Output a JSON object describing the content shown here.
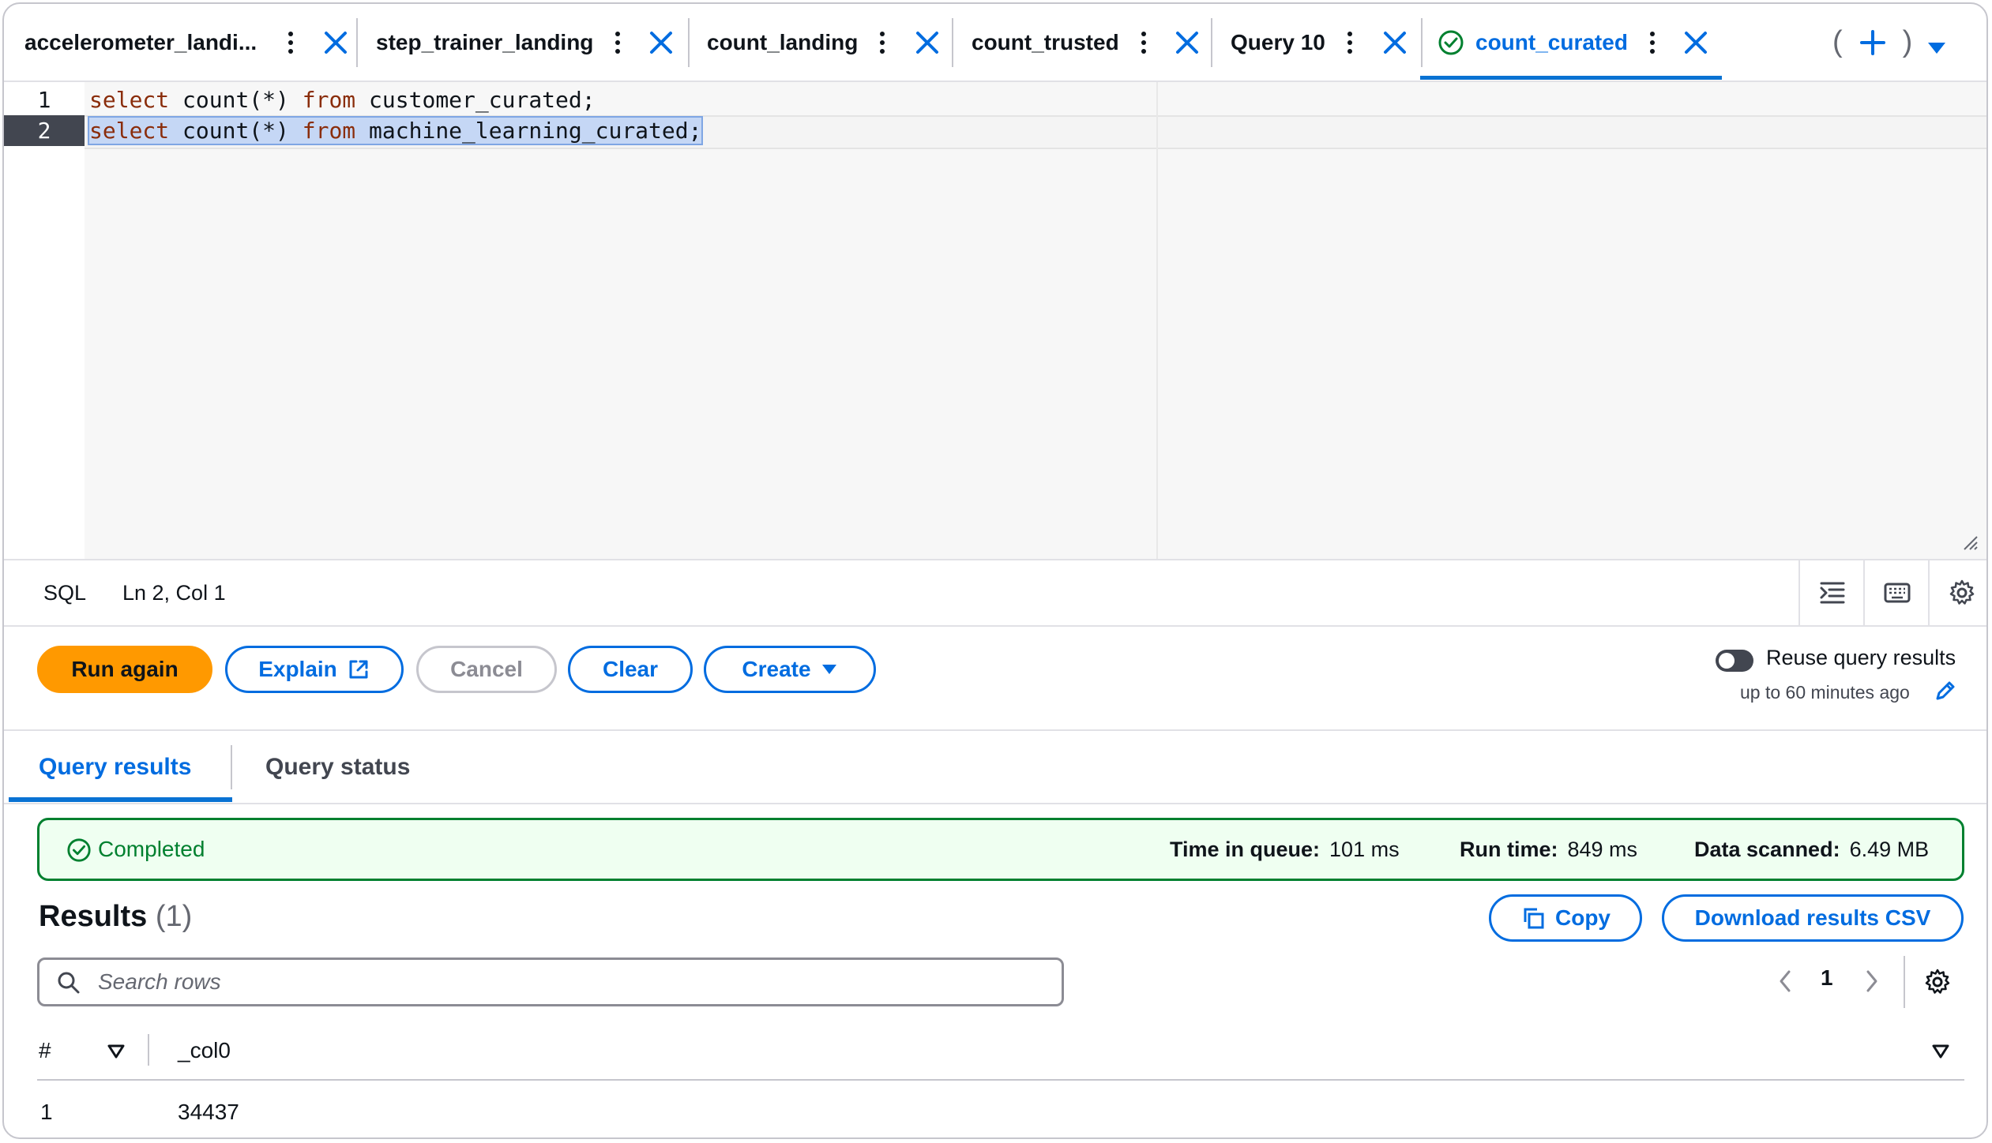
{
  "tabs": [
    {
      "label": "accelerometer_landi..."
    },
    {
      "label": "step_trainer_landing"
    },
    {
      "label": "count_landing"
    },
    {
      "label": "count_trusted"
    },
    {
      "label": "Query 10"
    },
    {
      "label": "count_curated"
    }
  ],
  "tab_actions": {
    "open_paren": "(",
    "close_paren": ")"
  },
  "editor": {
    "lines": [
      {
        "number": "1",
        "kw1": "select",
        "text1": " count(*) ",
        "kw2": "from",
        "text2": " customer_curated;"
      },
      {
        "number": "2",
        "kw1": "select",
        "text1": " count(*) ",
        "kw2": "from",
        "text2": " machine_learning_curated;"
      }
    ]
  },
  "statusbar": {
    "language": "SQL",
    "cursor": "Ln 2, Col 1"
  },
  "actions": {
    "run": "Run again",
    "explain": "Explain",
    "cancel": "Cancel",
    "clear": "Clear",
    "create": "Create",
    "reuse_label": "Reuse query results",
    "reuse_sub": "up to 60 minutes ago"
  },
  "result_tabs": {
    "results": "Query results",
    "status": "Query status"
  },
  "banner": {
    "status": "Completed",
    "queue_label": "Time in queue:",
    "queue_value": "101 ms",
    "run_label": "Run time:",
    "run_value": "849 ms",
    "scan_label": "Data scanned:",
    "scan_value": "6.49 MB"
  },
  "results": {
    "title": "Results",
    "count": "(1)",
    "copy": "Copy",
    "download": "Download results CSV",
    "search_placeholder": "Search rows",
    "page": "1",
    "columns": [
      "#",
      "_col0"
    ],
    "rows": [
      [
        "1",
        "34437"
      ]
    ]
  },
  "colors": {
    "accent": "#006ce0",
    "primary_button": "#ff9900",
    "success": "#00802f"
  }
}
